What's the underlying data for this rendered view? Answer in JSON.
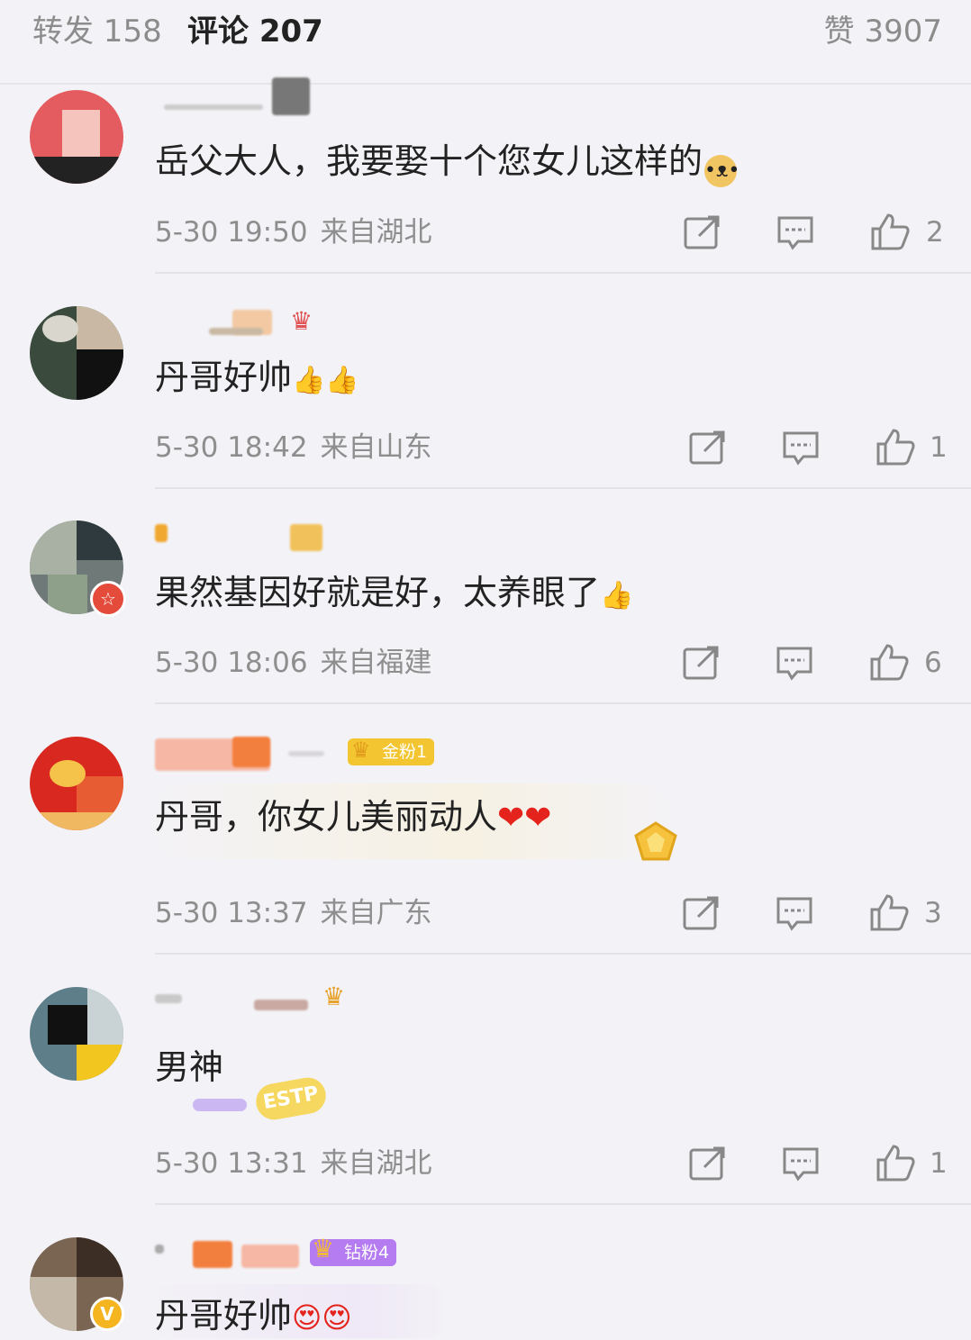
{
  "tabs": {
    "repost": "转发 158",
    "comments": "评论 207",
    "likes": "赞 3907"
  },
  "comments": [
    {
      "text": "岳父大人，我要娶十个您女儿这样的",
      "emoji": "doge-emoji",
      "time": "5-30 19:50",
      "location": "来自湖北",
      "likes": "2"
    },
    {
      "text": "丹哥好帅",
      "emoji": "thumbs-up-emoji",
      "time": "5-30 18:42",
      "location": "来自山东",
      "likes": "1"
    },
    {
      "text": "果然基因好就是好，太养眼了",
      "emoji": "thumbs-up-emoji",
      "time": "5-30 18:06",
      "location": "来自福建",
      "likes": "6"
    },
    {
      "text": "丹哥，你女儿美丽动人",
      "emoji": "heart-emoji",
      "time": "5-30 13:37",
      "location": "来自广东",
      "likes": "3",
      "badge": "金粉1"
    },
    {
      "text": "男神",
      "emoji": "",
      "time": "5-30 13:31",
      "location": "来自湖北",
      "likes": "1",
      "deco_text": "ESTP"
    },
    {
      "text": "丹哥好帅",
      "emoji": "heart-eyes-emoji",
      "badge": "钻粉4"
    }
  ],
  "colors": {
    "background": "#f3f2f6",
    "text": "#222222",
    "muted": "#8e8e8e",
    "gold_badge": "#f3c531",
    "purple_badge": "#b57bf0"
  }
}
